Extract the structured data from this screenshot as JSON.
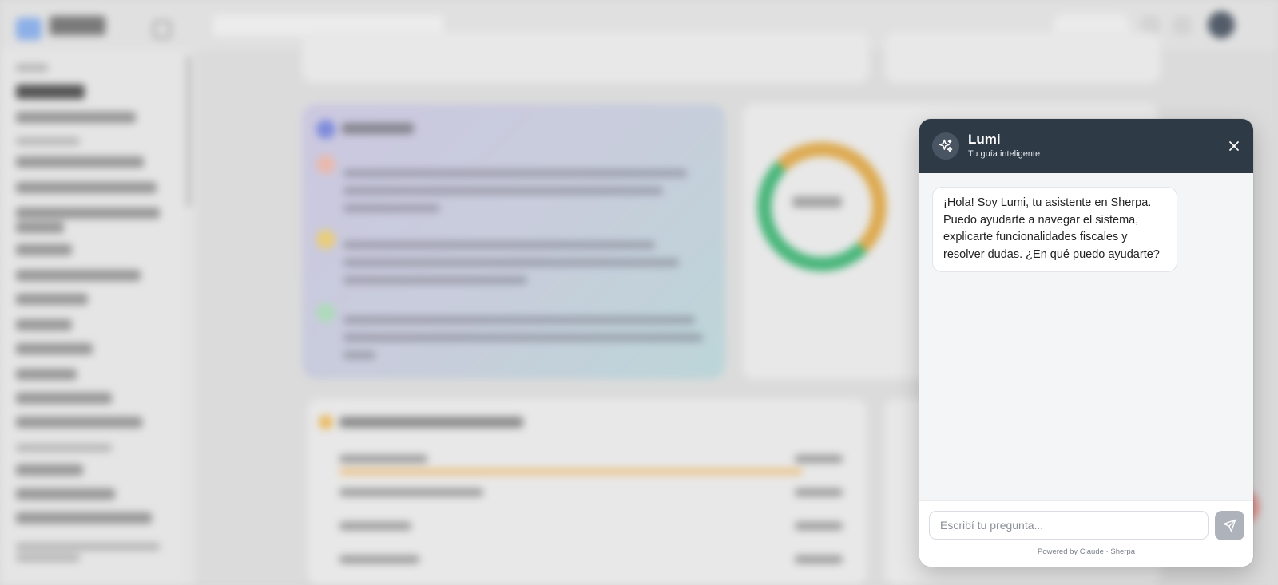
{
  "chat": {
    "title": "Lumi",
    "subtitle": "Tu guía inteligente",
    "messages": [
      {
        "role": "assistant",
        "text": "¡Hola! Soy Lumi, tu asistente en Sherpa. Puedo ayudarte a navegar el sistema, explicarte funcionalidades fiscales y resolver dudas. ¿En qué puedo ayudarte?"
      }
    ],
    "input_placeholder": "Escribí tu pregunta...",
    "powered_by": "Powered by Claude · Sherpa"
  },
  "icons": {
    "badge": "sparkles-icon",
    "close": "close-icon",
    "send": "send-icon"
  },
  "colors": {
    "header_bg": "#2f3a47",
    "send_bg": "#aeb3bb",
    "body_bg": "#f4f5f7"
  }
}
